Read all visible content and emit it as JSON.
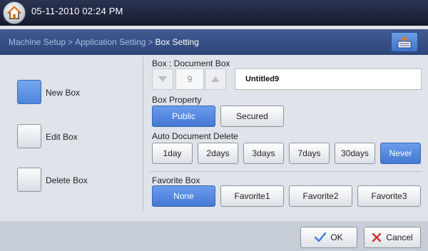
{
  "header": {
    "datetime": "05-11-2010 02:24 PM",
    "home_icon": "home-icon"
  },
  "breadcrumb": {
    "items": [
      "Machine Setup",
      "Application Setting"
    ],
    "current": "Box Setting",
    "separator": ">"
  },
  "tray_icon": "document-tray-icon",
  "sidebar": {
    "items": [
      {
        "label": "New Box",
        "selected": true
      },
      {
        "label": "Edit Box",
        "selected": false
      },
      {
        "label": "Delete Box",
        "selected": false
      }
    ]
  },
  "box": {
    "label": "Box : Document Box",
    "number": "9",
    "name": "Untitled9"
  },
  "box_property": {
    "label": "Box Property",
    "options": [
      {
        "label": "Public",
        "selected": true
      },
      {
        "label": "Secured",
        "selected": false
      }
    ]
  },
  "auto_delete": {
    "label": "Auto Document Delete",
    "options": [
      {
        "label": "1day",
        "selected": false
      },
      {
        "label": "2days",
        "selected": false
      },
      {
        "label": "3days",
        "selected": false
      },
      {
        "label": "7days",
        "selected": false
      },
      {
        "label": "30days",
        "selected": false
      },
      {
        "label": "Never",
        "selected": true
      }
    ]
  },
  "favorite_box": {
    "label": "Favorite Box",
    "options": [
      {
        "label": "None",
        "selected": true
      },
      {
        "label": "Favorite1",
        "selected": false
      },
      {
        "label": "Favorite2",
        "selected": false
      },
      {
        "label": "Favorite3",
        "selected": false
      }
    ]
  },
  "footer": {
    "ok_label": "OK",
    "cancel_label": "Cancel"
  },
  "colors": {
    "accent": "#4d84dd",
    "header_bg": "#1f2740",
    "crumb_bg": "#37507f"
  }
}
